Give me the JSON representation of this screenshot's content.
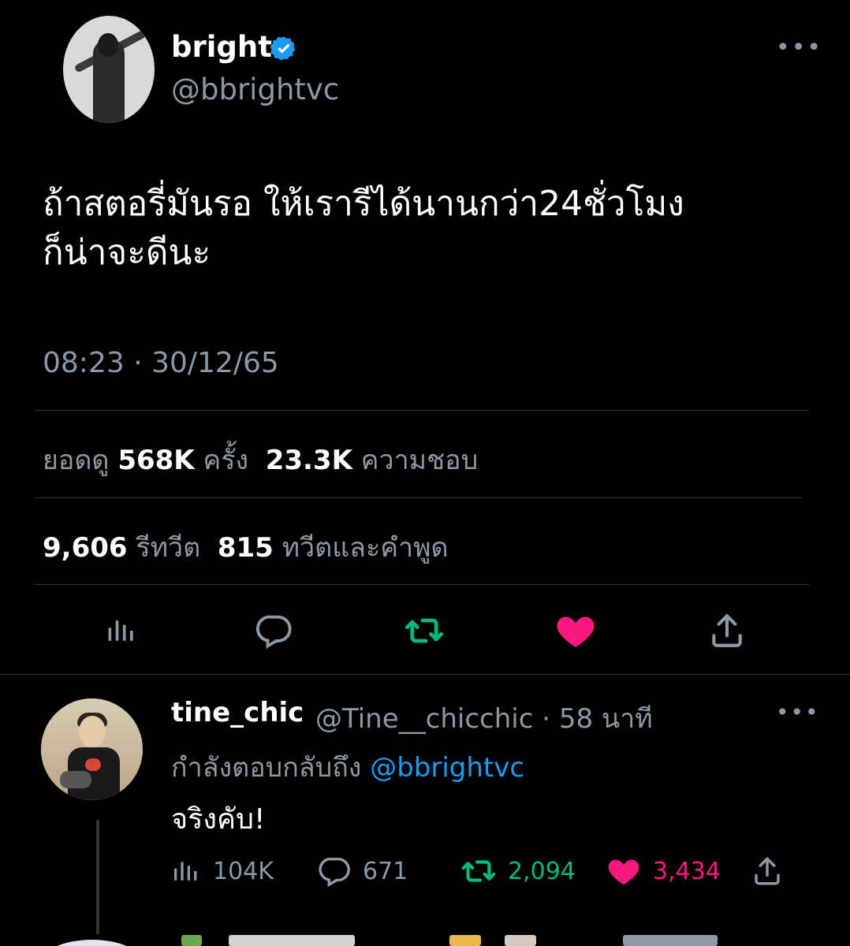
{
  "tweet": {
    "name": "bright",
    "handle": "@bbrightvc",
    "more_icon": "more-horizontal-icon",
    "text_line1": "ถ้าสตอรี่มันรอ ให้เรารีได้นานกว่า24ชั่วโมง",
    "text_line2": "ก็น่าจะดีนะ",
    "timestamp": "08:23 · 30/12/65",
    "views_label": "ยอดดู",
    "views_value": "568K",
    "views_unit": "ครั้ง",
    "likes_value": "23.3K",
    "likes_label": "ความชอบ",
    "retweets_value": "9,606",
    "retweets_label": "รีทวีต",
    "quotes_value": "815",
    "quotes_label": "ทวีตและคำพูด",
    "colors": {
      "verified": "#1d9bf0",
      "retweet": "#00ba7c",
      "like": "#f91880",
      "muted": "#8b98a5"
    }
  },
  "reply": {
    "name": "tine_chic",
    "meta": "@Tine__chicchic · 58 นาที",
    "replying_label": "กำลังตอบกลับถึง",
    "replying_mention": "@bbrightvc",
    "text": "จริงคับ!",
    "views": "104K",
    "replies": "671",
    "retweets": "2,094",
    "likes": "3,434"
  }
}
